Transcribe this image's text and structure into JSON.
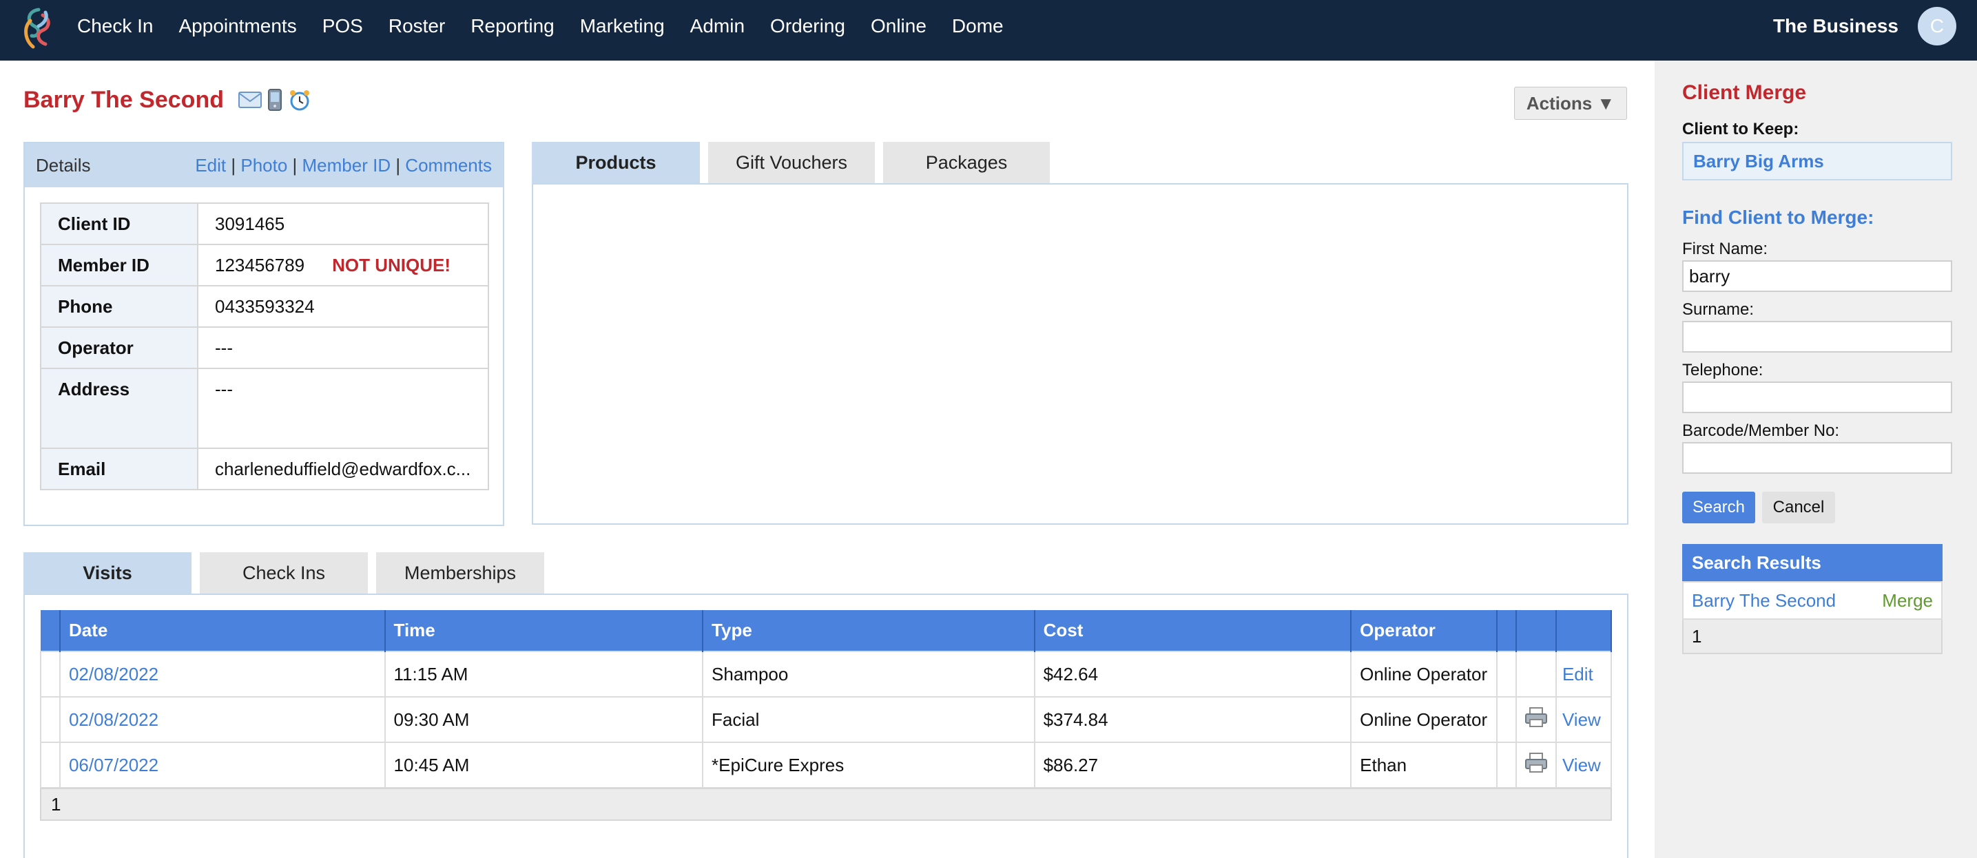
{
  "nav": {
    "items": [
      "Check In",
      "Appointments",
      "POS",
      "Roster",
      "Reporting",
      "Marketing",
      "Admin",
      "Ordering",
      "Online",
      "Dome"
    ],
    "business": "The Business",
    "avatar_initial": "C"
  },
  "client": {
    "name": "Barry The Second",
    "actions_label": "Actions ▼"
  },
  "details": {
    "title": "Details",
    "links": [
      "Edit",
      "Photo",
      "Member ID",
      "Comments"
    ],
    "rows": {
      "client_id": {
        "label": "Client ID",
        "value": "3091465"
      },
      "member_id": {
        "label": "Member ID",
        "value": "123456789",
        "warning": "NOT UNIQUE!"
      },
      "phone": {
        "label": "Phone",
        "value": "0433593324"
      },
      "operator": {
        "label": "Operator",
        "value": "---"
      },
      "address": {
        "label": "Address",
        "value": "---"
      },
      "email": {
        "label": "Email",
        "value": "charleneduffield@edwardfox.c..."
      }
    }
  },
  "top_tabs": [
    "Products",
    "Gift Vouchers",
    "Packages"
  ],
  "bottom_tabs": [
    "Visits",
    "Check Ins",
    "Memberships"
  ],
  "visits": {
    "headers": [
      "Date",
      "Time",
      "Type",
      "Cost",
      "Operator"
    ],
    "rows": [
      {
        "date": "02/08/2022",
        "time": "11:15 AM",
        "type": "Shampoo",
        "cost": "$42.64",
        "operator": "Online Operator",
        "action": "Edit",
        "print": false
      },
      {
        "date": "02/08/2022",
        "time": "09:30 AM",
        "type": "Facial",
        "cost": "$374.84",
        "operator": "Online Operator",
        "action": "View",
        "print": true
      },
      {
        "date": "06/07/2022",
        "time": "10:45 AM",
        "type": "*EpiCure Expres",
        "cost": "$86.27",
        "operator": "Ethan",
        "action": "View",
        "print": true
      }
    ],
    "pager": "1"
  },
  "merge": {
    "title": "Client Merge",
    "keep_label": "Client to Keep:",
    "keep_value": "Barry Big Arms",
    "find_title": "Find Client to Merge:",
    "first_name_label": "First Name:",
    "first_name_value": "barry",
    "surname_label": "Surname:",
    "surname_value": "",
    "telephone_label": "Telephone:",
    "telephone_value": "",
    "barcode_label": "Barcode/Member No:",
    "barcode_value": "",
    "search_label": "Search",
    "cancel_label": "Cancel",
    "results_title": "Search Results",
    "results": [
      {
        "name": "Barry The Second",
        "action": "Merge"
      }
    ],
    "results_pager": "1"
  },
  "colors": {
    "topbar": "#142740",
    "accent_red": "#c0282d",
    "link_blue": "#3f7ed6",
    "header_blue": "#4a82de",
    "panel_blue": "#c8daee",
    "merge_green": "#5e9a2e"
  }
}
